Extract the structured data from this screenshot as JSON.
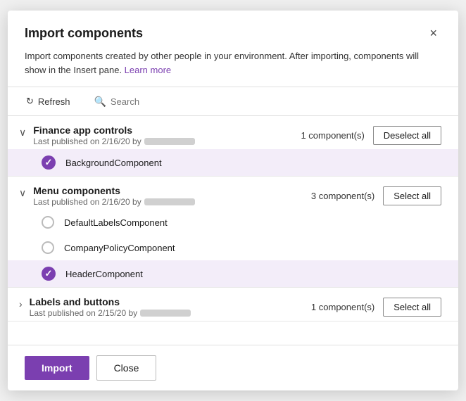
{
  "dialog": {
    "title": "Import components",
    "description": "Import components created by other people in your environment. After importing, components will show in the Insert pane.",
    "learn_more_label": "Learn more",
    "close_label": "×"
  },
  "toolbar": {
    "refresh_label": "Refresh",
    "search_placeholder": "Search"
  },
  "groups": [
    {
      "id": "finance",
      "name": "Finance app controls",
      "meta": "Last published on 2/16/20 by",
      "component_count": "1 component(s)",
      "action_label": "Deselect all",
      "expanded": true,
      "components": [
        {
          "name": "BackgroundComponent",
          "selected": true
        }
      ]
    },
    {
      "id": "menu",
      "name": "Menu components",
      "meta": "Last published on 2/16/20 by",
      "component_count": "3 component(s)",
      "action_label": "Select all",
      "expanded": true,
      "components": [
        {
          "name": "DefaultLabelsComponent",
          "selected": false
        },
        {
          "name": "CompanyPolicyComponent",
          "selected": false
        },
        {
          "name": "HeaderComponent",
          "selected": true
        }
      ]
    },
    {
      "id": "labels",
      "name": "Labels and buttons",
      "meta": "Last published on 2/15/20 by",
      "component_count": "1 component(s)",
      "action_label": "Select all",
      "expanded": false,
      "components": []
    }
  ],
  "footer": {
    "import_label": "Import",
    "cancel_label": "Close"
  },
  "colors": {
    "accent": "#7b3fb0",
    "selected_bg": "#f3edf9"
  }
}
